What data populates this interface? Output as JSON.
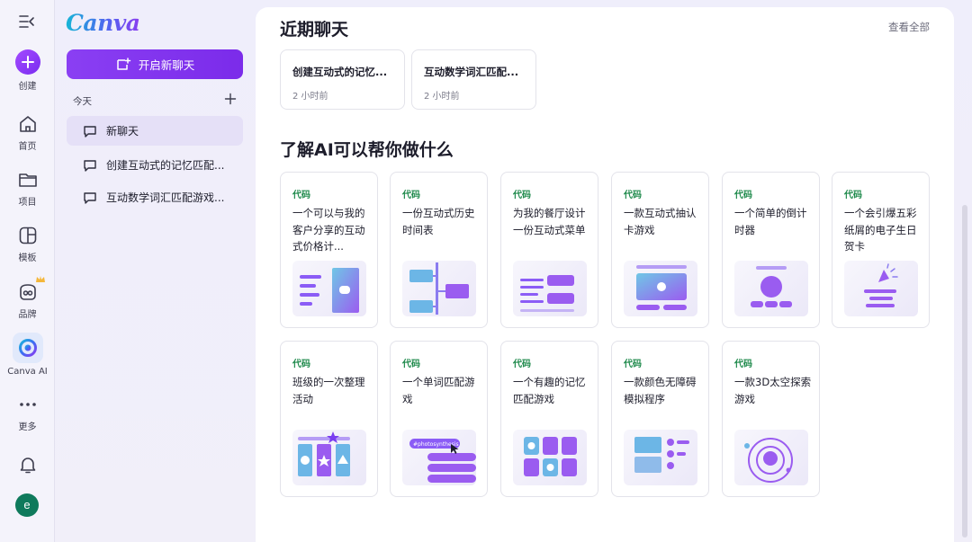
{
  "app": {
    "brand": "Canva"
  },
  "rail": {
    "items": [
      {
        "label": "创建",
        "icon": "plus-icon"
      },
      {
        "label": "首页",
        "icon": "home-icon"
      },
      {
        "label": "项目",
        "icon": "folder-icon"
      },
      {
        "label": "模板",
        "icon": "template-icon"
      },
      {
        "label": "品牌",
        "icon": "brand-icon"
      },
      {
        "label": "Canva AI",
        "icon": "canva-ai-icon"
      },
      {
        "label": "更多",
        "icon": "more-icon"
      }
    ],
    "avatar_letter": "e"
  },
  "sidebar": {
    "new_chat_label": "开启新聊天",
    "section_title": "今天",
    "chats": [
      {
        "label": "新聊天"
      },
      {
        "label": "创建互动式的记忆匹配..."
      },
      {
        "label": "互动数学词汇匹配游戏..."
      }
    ]
  },
  "main": {
    "recent_title": "近期聊天",
    "view_all": "查看全部",
    "recent": [
      {
        "title": "创建互动式的记忆...",
        "time": "2 小时前"
      },
      {
        "title": "互动数学词汇匹配...",
        "time": "2 小时前"
      }
    ],
    "learn_title": "了解AI可以帮你做什么",
    "cards": [
      {
        "tag": "代码",
        "desc": "一个可以与我的客户分享的互动式价格计..."
      },
      {
        "tag": "代码",
        "desc": "一份互动式历史时间表"
      },
      {
        "tag": "代码",
        "desc": "为我的餐厅设计一份互动式菜单"
      },
      {
        "tag": "代码",
        "desc": "一款互动式抽认卡游戏"
      },
      {
        "tag": "代码",
        "desc": "一个简单的倒计时器"
      },
      {
        "tag": "代码",
        "desc": "一个会引爆五彩纸屑的电子生日贺卡"
      },
      {
        "tag": "代码",
        "desc": "班级的一次整理活动"
      },
      {
        "tag": "代码",
        "desc": "一个单词匹配游戏"
      },
      {
        "tag": "代码",
        "desc": "一个有趣的记忆匹配游戏"
      },
      {
        "tag": "代码",
        "desc": "一款颜色无障碍模拟程序"
      },
      {
        "tag": "代码",
        "desc": "一款3D太空探索游戏"
      }
    ],
    "thumb_tag": "#photosynthesis"
  }
}
